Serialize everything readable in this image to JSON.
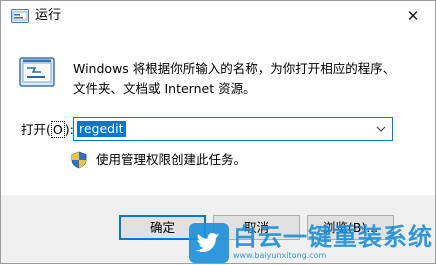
{
  "window": {
    "title": "运行",
    "close_glyph": "✕",
    "app_icon": "run-icon"
  },
  "main": {
    "icon": "run-dialog-icon",
    "description_line1": "Windows 将根据你所输入的名称，为你打开相应的程序、",
    "description_line2": "文件夹、文档或 Internet 资源。",
    "open_label_prefix": "打开(",
    "open_label_accel": "O",
    "open_label_suffix": "):",
    "input_value": "regedit",
    "admin_text": "使用管理权限创建此任务。"
  },
  "buttons": {
    "ok": "确定",
    "cancel": "取消",
    "browse": "浏览(B)..."
  },
  "watermark": {
    "text": "白云一键重装系统",
    "url": "www.baiyunxitong.com"
  },
  "colors": {
    "accent": "#0078d7",
    "watermark": "#1a8fd8",
    "footer": "#f0f0f0"
  }
}
